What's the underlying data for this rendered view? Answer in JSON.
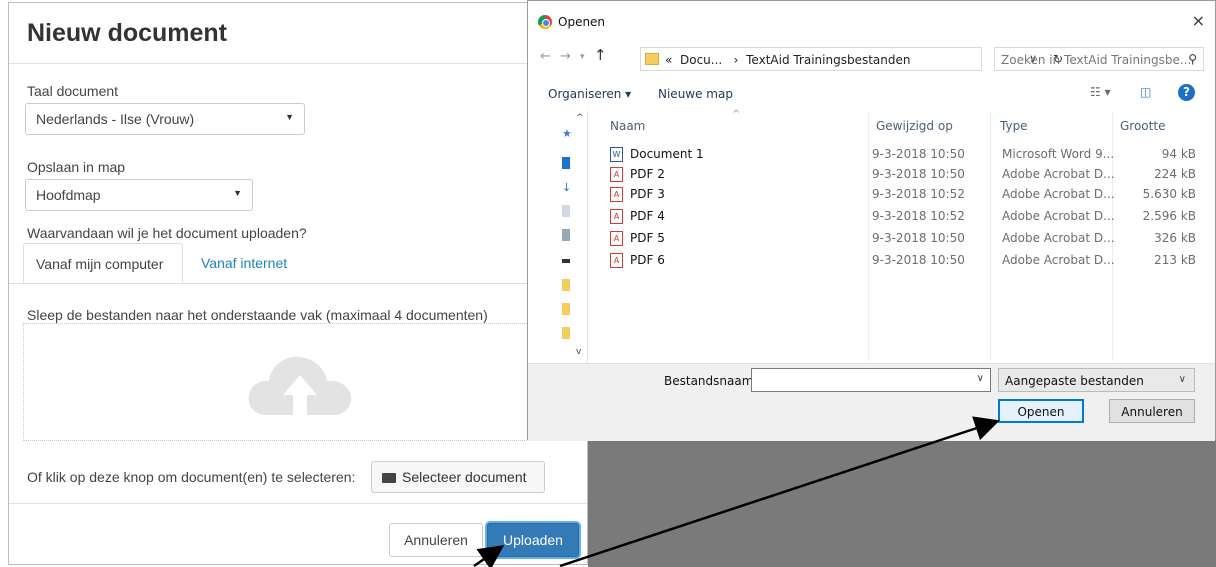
{
  "web_dialog": {
    "title": "Nieuw document",
    "language_label": "Taal document",
    "language_value": "Nederlands - Ilse (Vrouw)",
    "folder_label": "Opslaan in map",
    "folder_value": "Hoofdmap",
    "upload_question": "Waarvandaan wil je het document uploaden?",
    "tabs": [
      {
        "label": "Vanaf mijn computer",
        "active": true
      },
      {
        "label": "Vanaf internet",
        "active": false
      }
    ],
    "drop_instructions": "Sleep de bestanden naar het onderstaande vak (maximaal 4 documenten)",
    "select_prompt": "Of klik op deze knop om document(en) te selecteren:",
    "select_button": "Selecteer document",
    "cancel_button": "Annuleren",
    "upload_button": "Uploaden"
  },
  "file_dialog": {
    "title": "Openen",
    "close": "×",
    "address": {
      "prefix": "«",
      "segment1": "Docu...",
      "separator": "›",
      "segment2": "TextAid Trainingsbestanden"
    },
    "search_placeholder": "Zoeken in TextAid Trainingsbe...",
    "toolbar": {
      "organize": "Organiseren ▾",
      "new_folder": "Nieuwe map"
    },
    "columns": [
      "Naam",
      "Gewijzigd op",
      "Type",
      "Grootte"
    ],
    "files": [
      {
        "name": "Document 1",
        "date": "9-3-2018 10:50",
        "type": "Microsoft Word 9...",
        "size": "94 kB",
        "icon": "word-icon"
      },
      {
        "name": "PDF 2",
        "date": "9-3-2018 10:50",
        "type": "Adobe Acrobat D...",
        "size": "224 kB",
        "icon": "pdf-icon"
      },
      {
        "name": "PDF 3",
        "date": "9-3-2018 10:52",
        "type": "Adobe Acrobat D...",
        "size": "5.630 kB",
        "icon": "pdf-icon"
      },
      {
        "name": "PDF 4",
        "date": "9-3-2018 10:52",
        "type": "Adobe Acrobat D...",
        "size": "2.596 kB",
        "icon": "pdf-icon"
      },
      {
        "name": "PDF 5",
        "date": "9-3-2018 10:50",
        "type": "Adobe Acrobat D...",
        "size": "326 kB",
        "icon": "pdf-icon"
      },
      {
        "name": "PDF 6",
        "date": "9-3-2018 10:50",
        "type": "Adobe Acrobat D...",
        "size": "213 kB",
        "icon": "pdf-icon"
      }
    ],
    "filename_label": "Bestandsnaam:",
    "filename_value": "",
    "filetype_value": "Aangepaste bestanden",
    "open_button": "Openen",
    "cancel_button": "Annuleren"
  },
  "colors": {
    "primary_blue": "#337ab7",
    "link_blue": "#1f82c3",
    "backdrop_gray": "#7a7a7a",
    "win_accent": "#0078d7"
  }
}
